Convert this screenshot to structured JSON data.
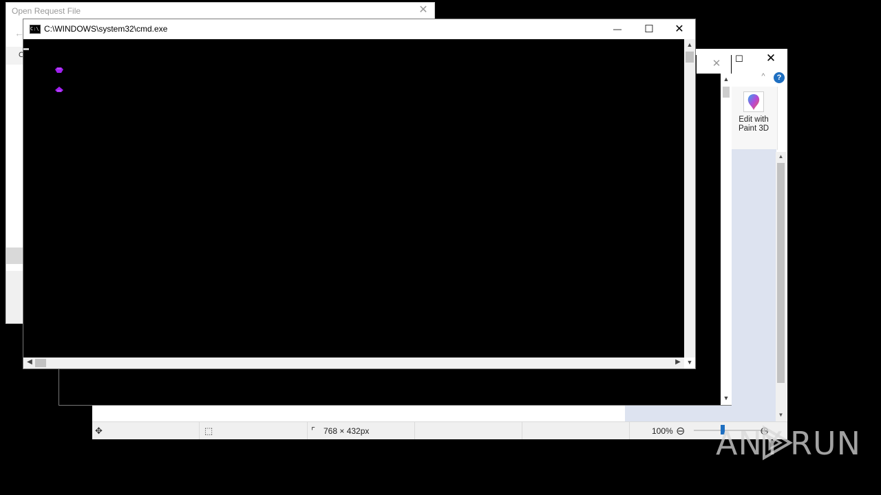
{
  "open_dialog": {
    "title": "Open Request File",
    "close_glyph": "✕",
    "back_glyph": "←",
    "partial_header": "O"
  },
  "paint": {
    "maximize_glyph": "☐",
    "close_glyph": "✕",
    "collapse_glyph": "^",
    "help_glyph": "?",
    "edit_with_paint3d_label": "Edit with Paint 3D",
    "status": {
      "move_icon": "move-icon",
      "selection_icon": "selection-icon",
      "size_icon": "image-size-icon",
      "image_size": "768 × 432px",
      "zoom_level": "100%",
      "zoom_out_glyph": "⊖",
      "zoom_in_glyph": "⊕"
    },
    "scroll_up_glyph": "▲",
    "scroll_down_glyph": "▼"
  },
  "middle_window": {
    "close_glyph": "✕",
    "scroll_up_glyph": "▲",
    "scroll_down_glyph": "▼"
  },
  "cmd": {
    "title": "C:\\WINDOWS\\system32\\cmd.exe",
    "icon_text": "C:\\",
    "minimize_glyph": "—",
    "maximize_glyph": "☐",
    "close_glyph": "✕",
    "console_glyph_color": "#a020f0",
    "scroll_up_glyph": "▲",
    "scroll_down_glyph": "▼",
    "scroll_left_glyph": "◀",
    "scroll_right_glyph": "▶"
  },
  "watermark": {
    "left": "ANY",
    "right": "RUN"
  }
}
